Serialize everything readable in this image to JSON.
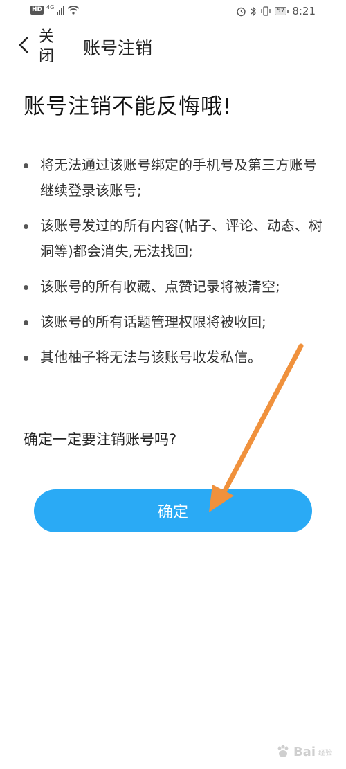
{
  "status_bar": {
    "hd": "HD",
    "network": "4G",
    "battery": "57",
    "time": "8:21",
    "icons": [
      "signal-icon",
      "wifi-icon",
      "alarm-icon",
      "bluetooth-icon",
      "vibrate-icon",
      "battery-icon"
    ]
  },
  "header": {
    "close_label": "关闭",
    "title": "账号注销"
  },
  "heading": "账号注销不能反悔哦!",
  "bullets": [
    "将无法通过该账号绑定的手机号及第三方账号继续登录该账号;",
    "该账号发过的所有内容(帖子、评论、动态、树洞等)都会消失,无法找回;",
    "该账号的所有收藏、点赞记录将被清空;",
    "该账号的所有话题管理权限将被收回;",
    "其他柚子将无法与该账号收发私信。"
  ],
  "question": "确定一定要注销账号吗?",
  "confirm_button": "确定",
  "colors": {
    "accent": "#2aaaf5",
    "arrow": "#f0913c"
  },
  "watermark": {
    "text": "Bai",
    "sub": "经验"
  }
}
